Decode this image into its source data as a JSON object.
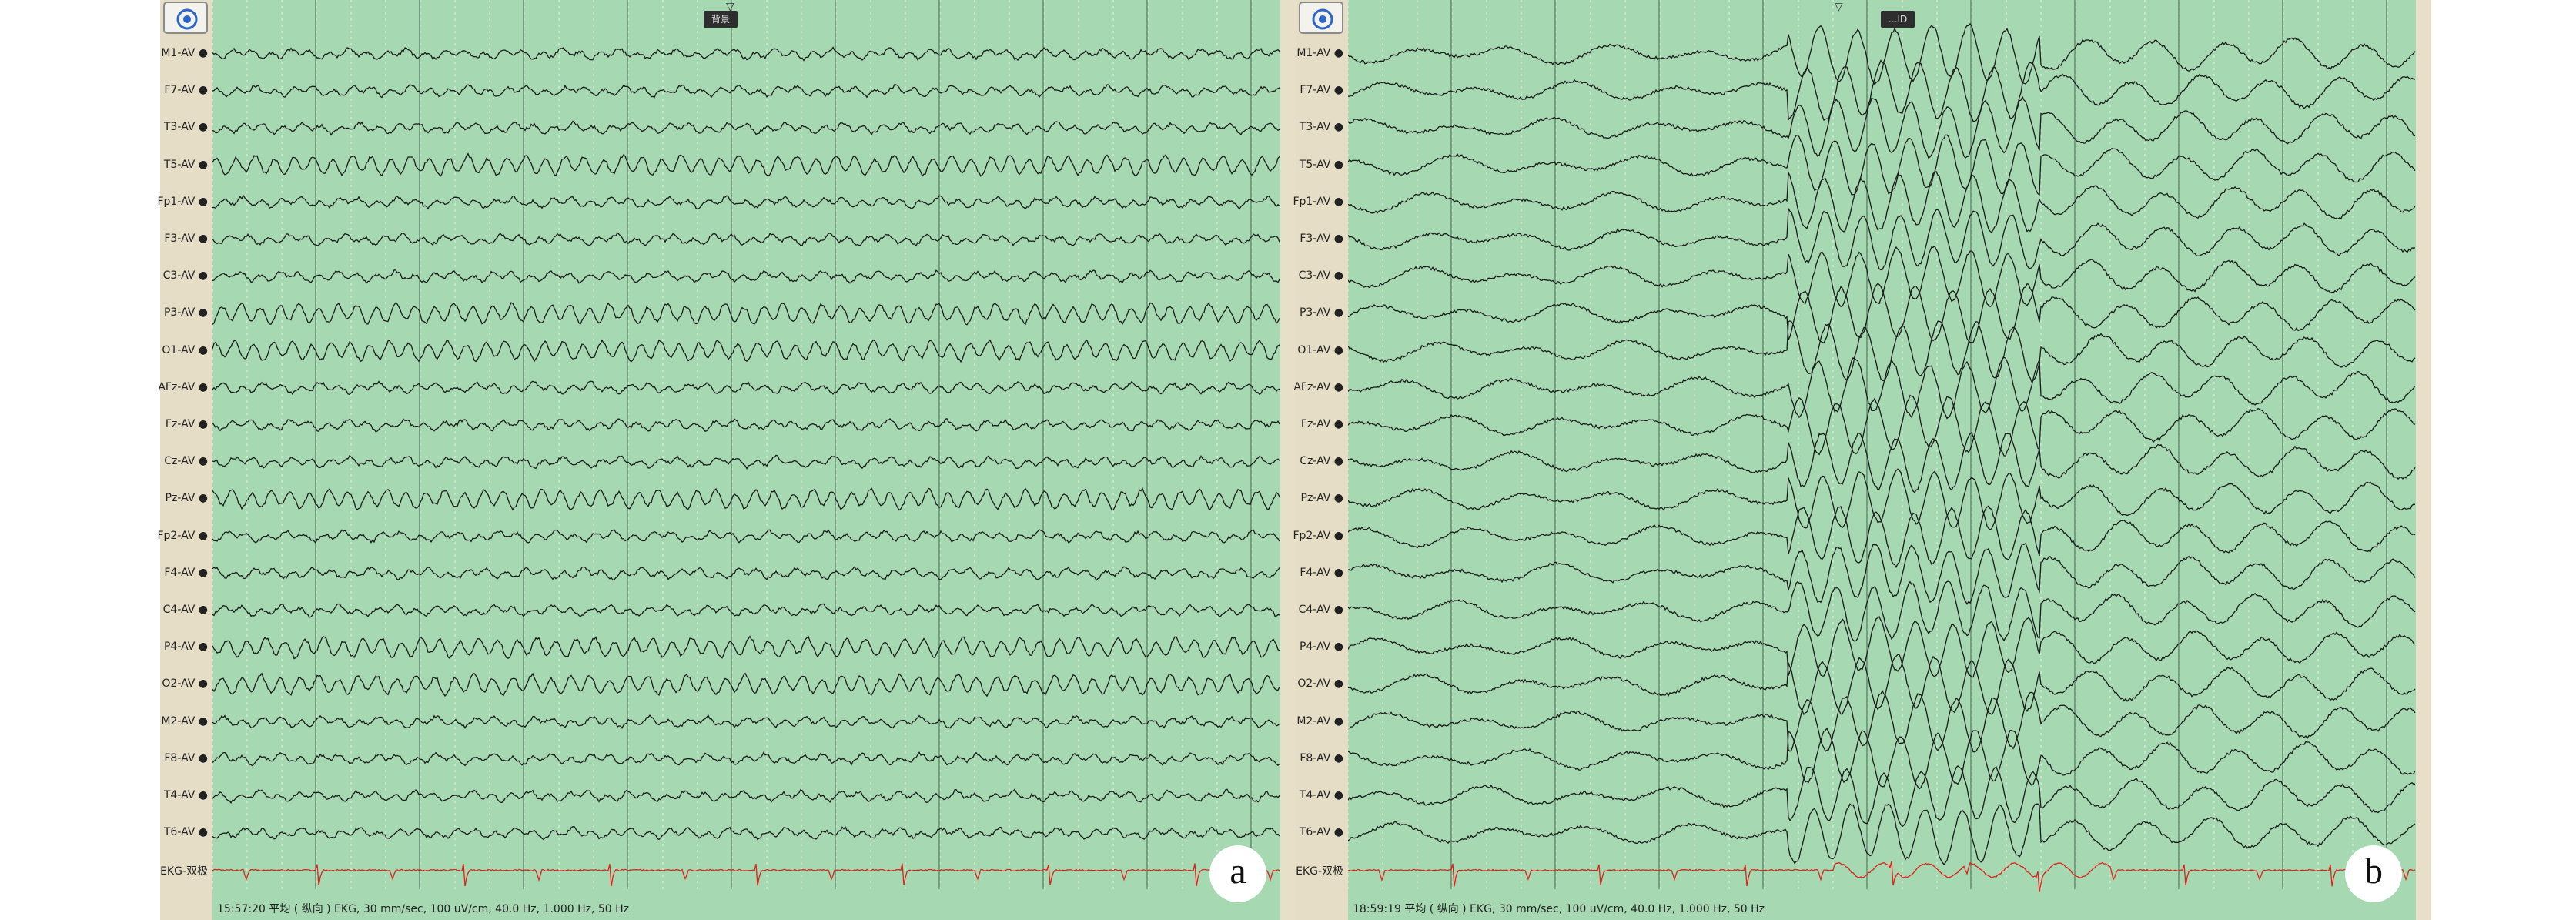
{
  "channels": [
    "M1-AV",
    "F7-AV",
    "T3-AV",
    "T5-AV",
    "Fp1-AV",
    "F3-AV",
    "C3-AV",
    "P3-AV",
    "O1-AV",
    "AFz-AV",
    "Fz-AV",
    "Cz-AV",
    "Pz-AV",
    "Fp2-AV",
    "F4-AV",
    "C4-AV",
    "P4-AV",
    "O2-AV",
    "M2-AV",
    "F8-AV",
    "T4-AV",
    "T6-AV",
    "EKG-双极"
  ],
  "panels": [
    {
      "letter": "a",
      "marker_label": "背景",
      "status": "15:57:20 平均 ( 纵向 ) EKG, 30 mm/sec, 100 uV/cm, 40.0 Hz, 1.000 Hz, 50 Hz",
      "settings_icon": "target-icon"
    },
    {
      "letter": "b",
      "marker_label": "...ID",
      "status": "18:59:19 平均 ( 纵向 ) EKG, 30 mm/sec, 100 uV/cm, 40.0 Hz, 1.000 Hz, 50 Hz",
      "settings_icon": "target-icon"
    }
  ],
  "colors": {
    "trace": "#1a1a1a",
    "ekg_trace": "#e0201a",
    "plot_background": "#a6d8b2",
    "gridline_major": "#5e8a6a",
    "gridline_minor": "#ffffff",
    "channel_column": "#e5ddc5"
  }
}
